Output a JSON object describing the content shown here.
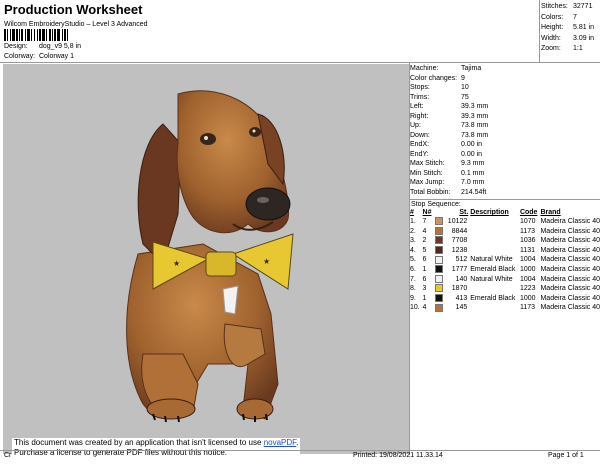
{
  "header": {
    "title": "Production Worksheet",
    "subtitle": "Wilcom EmbroideryStudio – Level 3 Advanced",
    "design_label": "Design:",
    "design_value": "dog_v9 5,8 in",
    "colorway_label": "Colorway:",
    "colorway_value": "Colorway 1"
  },
  "top_stats": [
    {
      "label": "Stitches:",
      "value": "32771"
    },
    {
      "label": "Colors:",
      "value": "7"
    },
    {
      "label": "Height:",
      "value": "5.81 in"
    },
    {
      "label": "Width:",
      "value": "3.09 in"
    },
    {
      "label": "Zoom:",
      "value": "1:1"
    }
  ],
  "machine_info": [
    {
      "label": "Machine:",
      "value": "Tajima"
    },
    {
      "label": "Color changes:",
      "value": "9"
    },
    {
      "label": "Stops:",
      "value": "10"
    },
    {
      "label": "Trims:",
      "value": "75"
    },
    {
      "label": "Left:",
      "value": "39.3 mm"
    },
    {
      "label": "Right:",
      "value": "39.3 mm"
    },
    {
      "label": "Up:",
      "value": "73.8 mm"
    },
    {
      "label": "Down:",
      "value": "73.8 mm"
    },
    {
      "label": "EndX:",
      "value": "0.00 in"
    },
    {
      "label": "EndY:",
      "value": "0.00 in"
    },
    {
      "label": "Max Stitch:",
      "value": "9.3 mm"
    },
    {
      "label": "Min Stitch:",
      "value": "0.1 mm"
    },
    {
      "label": "Max Jump:",
      "value": "7.0 mm"
    },
    {
      "label": "Total Bobbin:",
      "value": "214.54ft"
    }
  ],
  "stop_sequence": {
    "title": "Stop Sequence:",
    "columns": [
      "#",
      "N#",
      "St.",
      "Description",
      "Code",
      "Brand"
    ],
    "rows": [
      {
        "num": "1.",
        "n": "7",
        "color": "#c8955a",
        "st": "10122",
        "desc": "",
        "code": "1070",
        "brand": "Madeira Classic 40"
      },
      {
        "num": "2.",
        "n": "4",
        "color": "#b8733a",
        "st": "8844",
        "desc": "",
        "code": "1173",
        "brand": "Madeira Classic 40"
      },
      {
        "num": "3.",
        "n": "2",
        "color": "#6a3a28",
        "st": "7708",
        "desc": "",
        "code": "1036",
        "brand": "Madeira Classic 40"
      },
      {
        "num": "4.",
        "n": "5",
        "color": "#4a2c22",
        "st": "1238",
        "desc": "",
        "code": "1131",
        "brand": "Madeira Classic 40"
      },
      {
        "num": "5.",
        "n": "6",
        "color": "#f2f2f2",
        "st": "512",
        "desc": "Natural White",
        "code": "1004",
        "brand": "Madeira Classic 40"
      },
      {
        "num": "6.",
        "n": "1",
        "color": "#111111",
        "st": "1777",
        "desc": "Emerald Black",
        "code": "1000",
        "brand": "Madeira Classic 40"
      },
      {
        "num": "7.",
        "n": "6",
        "color": "#f2f2f2",
        "st": "140",
        "desc": "Natural White",
        "code": "1004",
        "brand": "Madeira Classic 40"
      },
      {
        "num": "8.",
        "n": "3",
        "color": "#e8c832",
        "st": "1870",
        "desc": "",
        "code": "1223",
        "brand": "Madeira Classic 40"
      },
      {
        "num": "9.",
        "n": "1",
        "color": "#111111",
        "st": "413",
        "desc": "Emerald Black",
        "code": "1000",
        "brand": "Madeira Classic 40"
      },
      {
        "num": "10.",
        "n": "4",
        "color": "#b8733a",
        "st": "145",
        "desc": "",
        "code": "1173",
        "brand": "Madeira Classic 40"
      }
    ]
  },
  "notice": {
    "line1": "This document was created by an application that isn't licensed to use",
    "link": "novaPDF",
    "line1_end": ".",
    "line2": "Purchase a license to generate PDF files without this notice."
  },
  "footer": {
    "left": "Cr",
    "printed": "Printed: 19/08/2021 11.33.14",
    "page": "Page 1 of 1"
  },
  "colors": {
    "canvas_bg": "#c0c0c0",
    "bow_yellow": "#e8c832",
    "fur_brown": "#a0622e",
    "link_blue": "#1a4fd6"
  }
}
